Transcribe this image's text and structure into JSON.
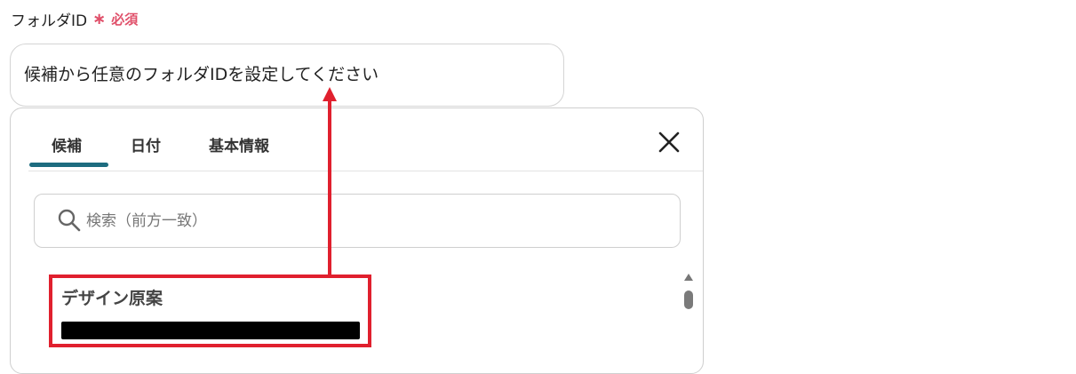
{
  "field": {
    "label": "フォルダID",
    "required_mark": "∗",
    "required_text": "必須",
    "value": "候補から任意のフォルダIDを設定してください"
  },
  "picker": {
    "tabs": [
      {
        "label": "候補",
        "active": true
      },
      {
        "label": "日付",
        "active": false
      },
      {
        "label": "基本情報",
        "active": false
      }
    ],
    "search_placeholder": "検索（前方一致）",
    "items": [
      {
        "title": "デザイン原案",
        "subtitle_redacted": true
      }
    ]
  },
  "colors": {
    "required": "#e0506a",
    "tab_active_underline": "#1d6c7f",
    "annotation_red": "#e0202e"
  }
}
